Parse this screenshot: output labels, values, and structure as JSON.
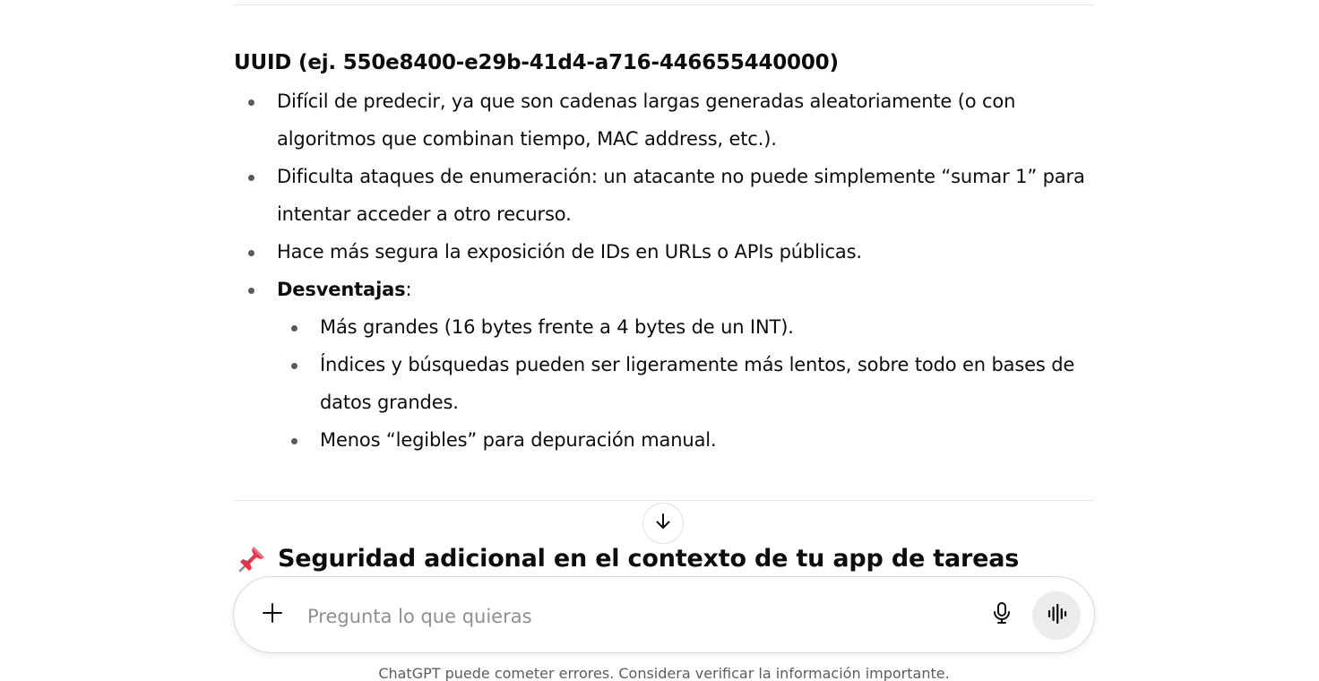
{
  "message": {
    "section_heading": "UUID (ej. 550e8400-e29b-41d4-a716-446655440000)",
    "bullets": [
      "Difícil de predecir, ya que son cadenas largas generadas aleatoriamente (o con algoritmos que combinan tiempo, MAC address, etc.).",
      "Dificulta ataques de enumeración: un atacante no puede simplemente “sumar 1” para intentar acceder a otro recurso.",
      "Hace más segura la exposición de IDs en URLs o APIs públicas."
    ],
    "disadvantages_label": "Desventajas",
    "disadvantages_suffix": ":",
    "disadvantages": [
      "Más grandes (16 bytes frente a 4 bytes de un INT).",
      "Índices y búsquedas pueden ser ligeramente más lentos, sobre todo en bases de datos grandes.",
      "Menos “legibles” para depuración manual."
    ],
    "next_heading": "Seguridad adicional en el contexto de tu app de tareas",
    "next_heading_icon": "pushpin-icon"
  },
  "composer": {
    "placeholder": "Pregunta lo que quieras",
    "add_icon": "plus-icon",
    "mic_icon": "microphone-icon",
    "voice_icon": "voice-waveform-icon"
  },
  "footer": {
    "disclaimer": "ChatGPT puede cometer errores. Considera verificar la información importante."
  },
  "colors": {
    "text": "#0d0d0d",
    "placeholder": "#8f8f8f",
    "divider": "#e5e5e5",
    "voice_button_bg": "#ececec",
    "pin_red": "#e3344c"
  }
}
